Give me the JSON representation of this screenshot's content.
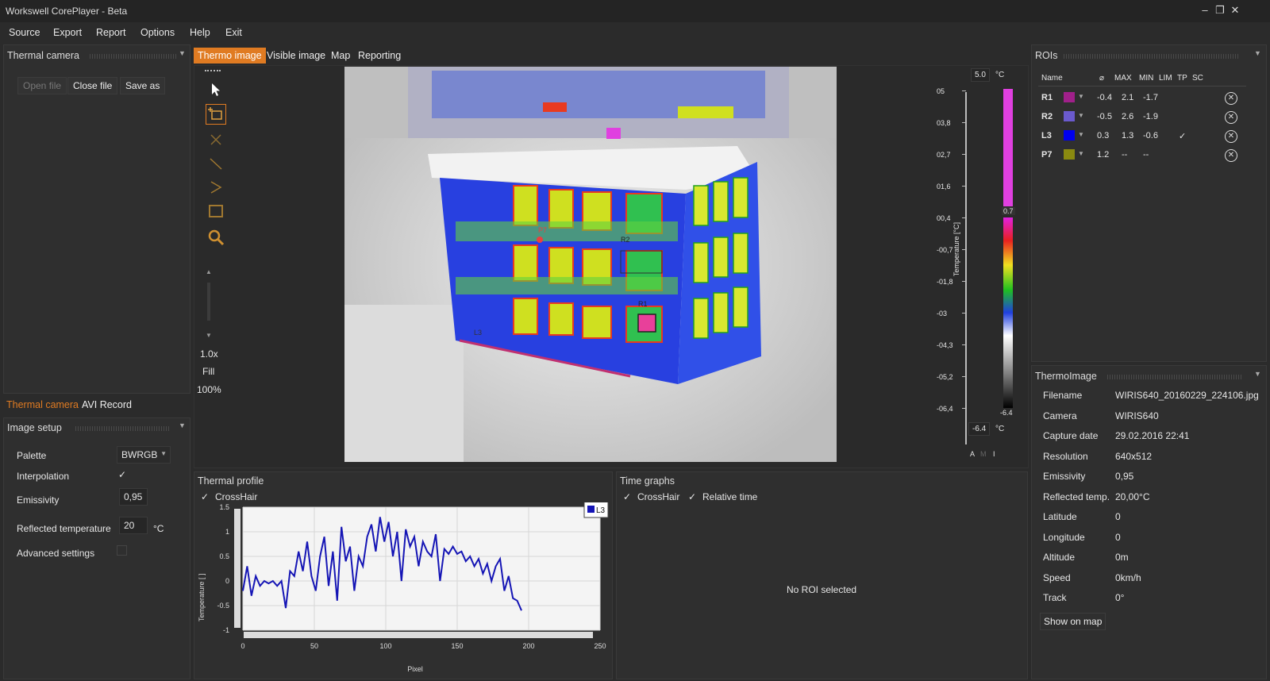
{
  "app": {
    "title": "Workswell CorePlayer - Beta"
  },
  "menu": [
    "Source",
    "Export",
    "Report",
    "Options",
    "Help",
    "Exit"
  ],
  "left": {
    "panel_title": "Thermal camera",
    "buttons": {
      "open": "Open file",
      "close": "Close file",
      "save": "Save as"
    },
    "tabs": [
      "Thermal camera",
      "AVI Record"
    ],
    "image_setup_title": "Image setup",
    "setup": {
      "palette_label": "Palette",
      "palette_value": "BWRGB",
      "interpolation_label": "Interpolation",
      "interpolation_check": "✓",
      "emissivity_label": "Emissivity",
      "emissivity_value": "0,95",
      "reflected_label": "Reflected temperature",
      "reflected_value": "20",
      "reflected_unit": "°C",
      "advanced_label": "Advanced settings"
    }
  },
  "center": {
    "tabs": [
      "Thermo image",
      "Visible image",
      "Map",
      "Reporting"
    ],
    "toolbar": {
      "zoom": "1.0x",
      "fill": "Fill",
      "percent": "100%"
    },
    "markers": [
      "P7",
      "R2",
      "R1",
      "L3"
    ],
    "scale": {
      "max": "5.0",
      "min": "-6.4",
      "unit": "°C",
      "level_high": "0.7",
      "level_low": "-6.4",
      "ticks": [
        "05",
        "03,8",
        "02,7",
        "01,6",
        "00,4",
        "-00,7",
        "-01,8",
        "-03",
        "-04,3",
        "-05,2",
        "-06,4"
      ],
      "axis_label": "Temperature [°C]",
      "mode": [
        "A",
        "M",
        "I"
      ],
      "colors": {
        "magenta": "#e040e0",
        "red": "#e82020",
        "yellow": "#f0e020",
        "green": "#20c020",
        "blue": "#2040e0"
      }
    }
  },
  "roi": {
    "title": "ROIs",
    "columns": [
      "Name",
      "⌀",
      "MAX",
      "MIN",
      "LIM",
      "TP",
      "SC"
    ],
    "rows": [
      {
        "name": "R1",
        "color": "#a0208a",
        "avg": "-0.4",
        "max": "2.1",
        "min": "-1.7",
        "tp": ""
      },
      {
        "name": "R2",
        "color": "#6a5acd",
        "avg": "-0.5",
        "max": "2.6",
        "min": "-1.9",
        "tp": ""
      },
      {
        "name": "L3",
        "color": "#0000ee",
        "avg": "0.3",
        "max": "1.3",
        "min": "-0.6",
        "tp": "✓"
      },
      {
        "name": "P7",
        "color": "#8a8a10",
        "avg": "1.2",
        "max": "--",
        "min": "--",
        "tp": ""
      }
    ]
  },
  "thermo": {
    "title": "ThermoImage",
    "fields": [
      {
        "k": "Filename",
        "v": "WIRIS640_20160229_224106.jpg"
      },
      {
        "k": "Camera",
        "v": "WIRIS640"
      },
      {
        "k": "Capture date",
        "v": "29.02.2016 22:41"
      },
      {
        "k": "Resolution",
        "v": "640x512"
      },
      {
        "k": "Emissivity",
        "v": "0,95"
      },
      {
        "k": "Reflected temp.",
        "v": "20,00°C"
      },
      {
        "k": "Latitude",
        "v": "0"
      },
      {
        "k": "Longitude",
        "v": "0"
      },
      {
        "k": "Altitude",
        "v": "0m"
      },
      {
        "k": "Speed",
        "v": "0km/h"
      },
      {
        "k": "Track",
        "v": "0°"
      }
    ],
    "show_map": "Show on map"
  },
  "profile": {
    "title": "Thermal profile",
    "crosshair": "CrossHair",
    "legend": "L3",
    "ylabel": "Temperature [ ]",
    "xlabel": "Pixel",
    "yticks": [
      "1.5",
      "1",
      "0.5",
      "0",
      "-0.5",
      "-1"
    ],
    "xticks": [
      "0",
      "50",
      "100",
      "150",
      "200",
      "250"
    ]
  },
  "timegraphs": {
    "title": "Time graphs",
    "crosshair": "CrossHair",
    "relative": "Relative time",
    "empty": "No ROI selected"
  },
  "chart_data": {
    "type": "line",
    "xlabel": "Pixel",
    "ylabel": "Temperature [ ]",
    "xlim": [
      0,
      250
    ],
    "ylim": [
      -1,
      1.5
    ],
    "series": [
      {
        "name": "L3",
        "color": "#1515b5",
        "x": [
          0,
          3,
          6,
          9,
          12,
          15,
          18,
          21,
          24,
          27,
          30,
          33,
          36,
          39,
          42,
          45,
          48,
          51,
          54,
          57,
          60,
          63,
          66,
          69,
          72,
          75,
          78,
          81,
          84,
          87,
          90,
          93,
          96,
          99,
          102,
          105,
          108,
          111,
          114,
          117,
          120,
          123,
          126,
          129,
          132,
          135,
          138,
          141,
          144,
          147,
          150,
          153,
          156,
          159,
          162,
          165,
          168,
          171,
          174,
          177,
          180,
          183,
          186,
          189,
          192,
          195
        ],
        "y": [
          -0.2,
          0.3,
          -0.3,
          0.1,
          -0.1,
          0.0,
          -0.05,
          0.0,
          -0.1,
          0.0,
          -0.55,
          0.2,
          0.1,
          0.6,
          0.2,
          0.8,
          0.1,
          -0.2,
          0.5,
          0.9,
          -0.1,
          0.6,
          -0.4,
          1.1,
          0.4,
          0.7,
          -0.2,
          0.5,
          0.3,
          0.9,
          1.15,
          0.6,
          1.3,
          0.8,
          1.2,
          0.5,
          1.0,
          0.0,
          1.05,
          0.7,
          0.9,
          0.3,
          0.8,
          0.6,
          0.5,
          0.95,
          0.0,
          0.65,
          0.55,
          0.7,
          0.55,
          0.6,
          0.4,
          0.5,
          0.3,
          0.45,
          0.15,
          0.35,
          0.0,
          0.3,
          0.45,
          -0.2,
          0.1,
          -0.35,
          -0.4,
          -0.6
        ]
      }
    ]
  }
}
